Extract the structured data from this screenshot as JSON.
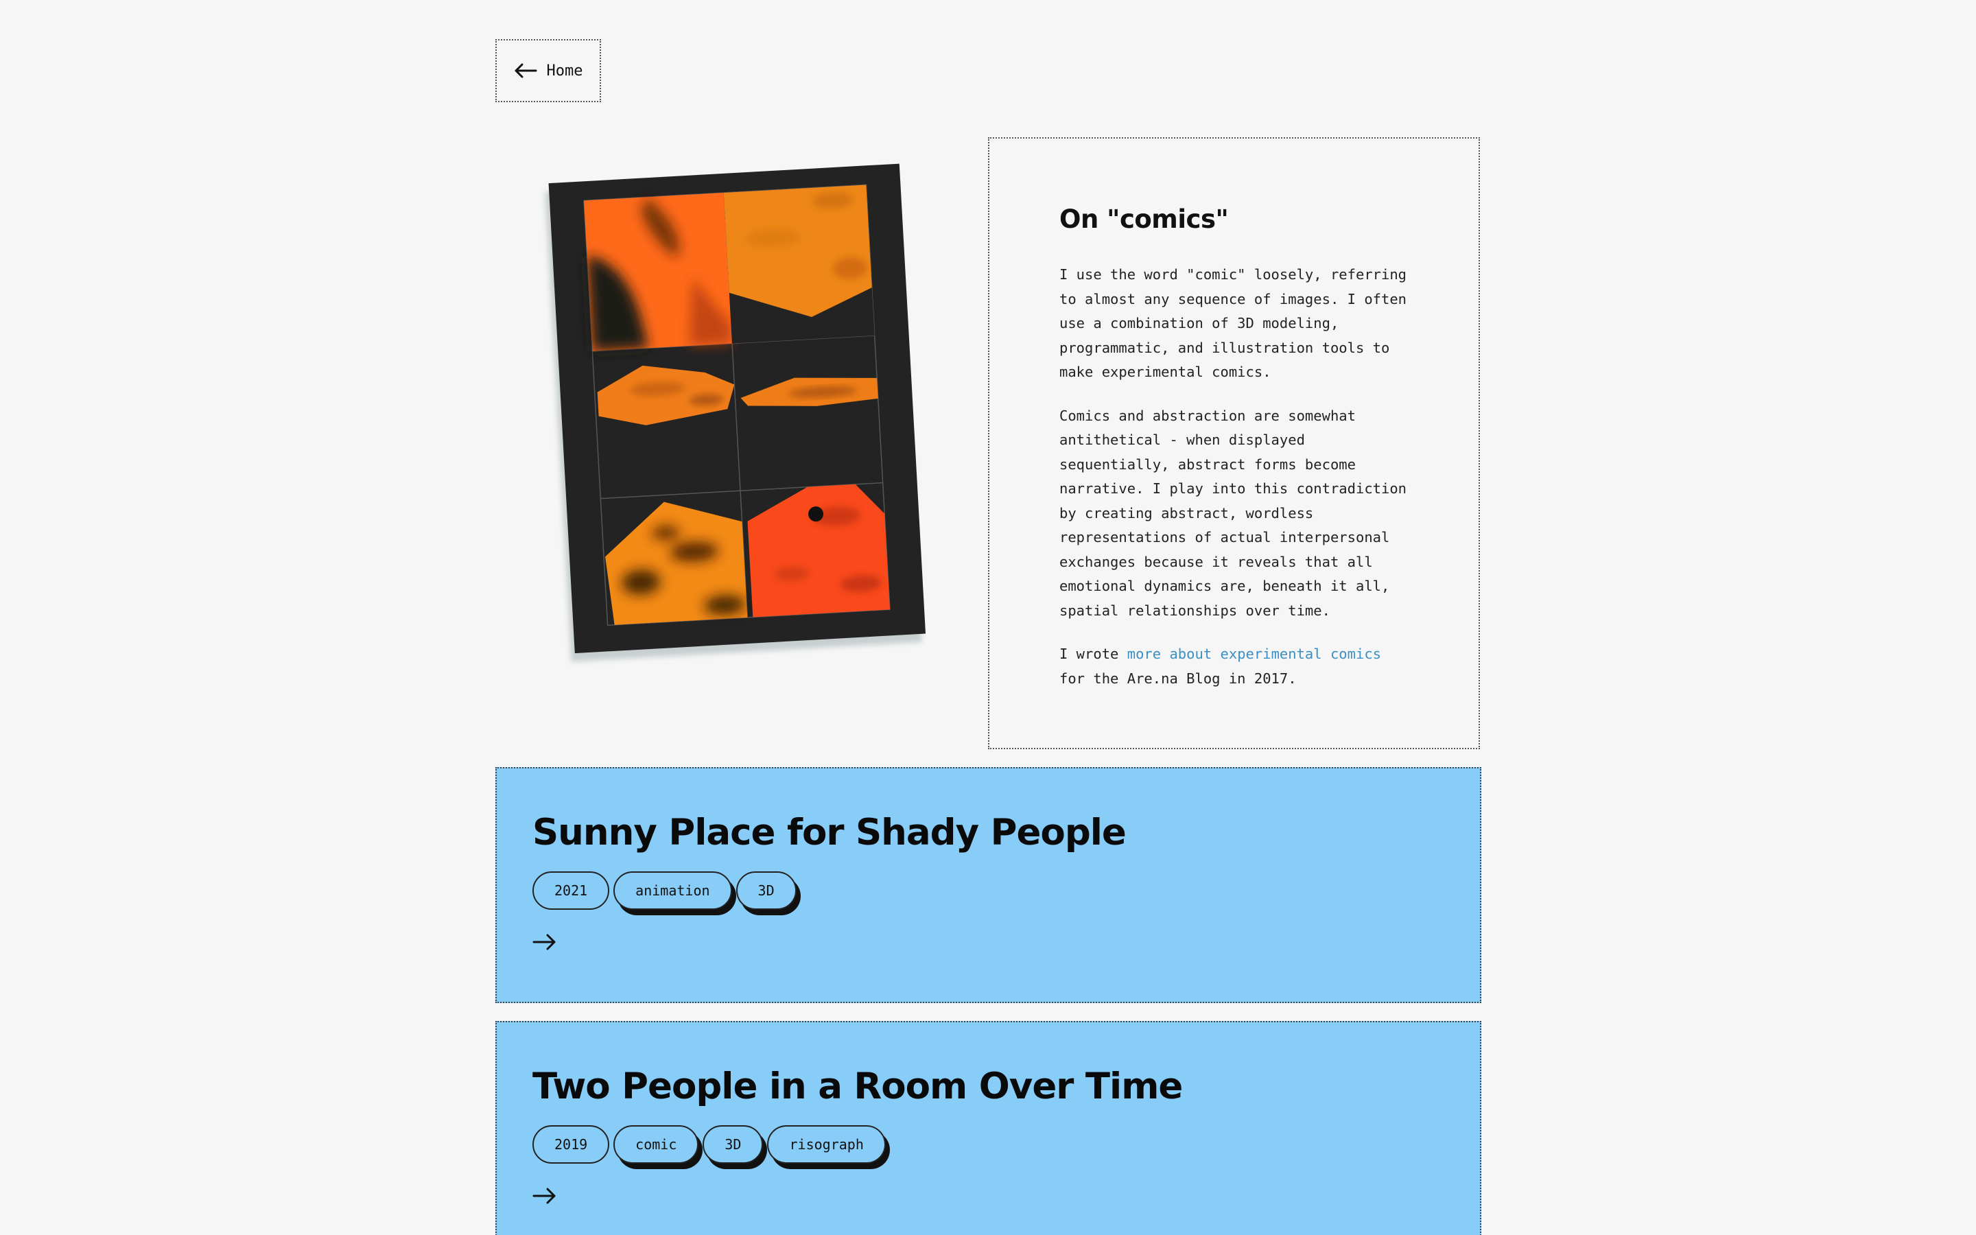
{
  "nav": {
    "home_label": "Home",
    "back_icon": "arrow-left-icon"
  },
  "artwork": {
    "panel_colors": [
      "#ff6a1a",
      "#f08a17",
      "#f07d1a",
      "#ee7d18",
      "#f28a15",
      "#fa4a1c"
    ],
    "frame_color": "#232323"
  },
  "about": {
    "title": "On \"comics\"",
    "paragraph1": "I use the word \"comic\" loosely, referring to almost any sequence of images. I often use a combination of 3D modeling, programmatic, and illustration tools to make experimental comics.",
    "paragraph2": "Comics and abstraction are somewhat antithetical - when displayed sequentially, abstract forms become narrative. I play into this contradiction by creating abstract, wordless representations of actual interpersonal exchanges because it reveals that all emotional dynamics are, beneath it all, spatial relationships over time.",
    "paragraph3_before": "I wrote ",
    "paragraph3_link": "more about experimental comics",
    "paragraph3_after": " for the Are.na Blog in 2017."
  },
  "projects": [
    {
      "title": "Sunny Place for Shady People",
      "tags": [
        "2021",
        "animation",
        "3D"
      ],
      "arrow_icon": "arrow-right-icon"
    },
    {
      "title": "Two People in a Room Over Time",
      "tags": [
        "2019",
        "comic",
        "3D",
        "risograph"
      ],
      "arrow_icon": "arrow-right-icon"
    }
  ],
  "colors": {
    "background": "#f6f6f6",
    "card": "#88ccf8",
    "link": "#3a8fc4"
  }
}
